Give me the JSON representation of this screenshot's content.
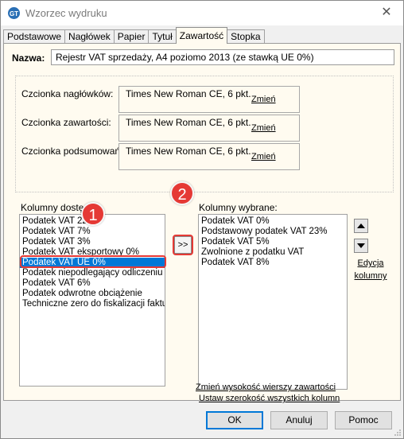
{
  "window": {
    "title": "Wzorzec wydruku",
    "close_icon": "close-icon"
  },
  "tabs": [
    {
      "label": "Podstawowe",
      "active": false
    },
    {
      "label": "Nagłówek",
      "active": false
    },
    {
      "label": "Papier",
      "active": false
    },
    {
      "label": "Tytuł",
      "active": false
    },
    {
      "label": "Zawartość",
      "active": true
    },
    {
      "label": "Stopka",
      "active": false
    }
  ],
  "name": {
    "label": "Nazwa:",
    "value": "Rejestr VAT sprzedaży, A4 poziomo 2013 (ze stawką UE 0%)"
  },
  "fonts": [
    {
      "label": "Czcionka nagłówków:",
      "value": "Times New Roman CE, 6 pkt.",
      "change": "Zmień"
    },
    {
      "label": "Czcionka zawartości:",
      "value": "Times New Roman CE, 6 pkt.",
      "change": "Zmień"
    },
    {
      "label": "Czcionka podsumowań:",
      "value": "Times New Roman CE, 6 pkt.",
      "change": "Zmień"
    }
  ],
  "available": {
    "label": "Kolumny dostępne:",
    "items": [
      "Podatek VAT 22%",
      "Podatek VAT 7%",
      "Podatek VAT 3%",
      "Podatek VAT eksportowy 0%",
      "Podatek VAT UE 0%",
      "Podatek niepodlegający odliczeniu",
      "Podatek VAT 6%",
      "Podatek odwrotne obciążenie",
      "Techniczne zero do fiskalizacji faktur r"
    ],
    "selected_index": 4
  },
  "move_button": ">>",
  "selected_columns": {
    "label": "Kolumny wybrane:",
    "items": [
      "Podatek VAT 0%",
      "Podstawowy podatek VAT 23%",
      "Podatek VAT 5%",
      "Zwolnione z podatku VAT",
      "Podatek VAT 8%"
    ]
  },
  "edit_columns": {
    "line1": "Edycja",
    "line2": "kolumny"
  },
  "links": {
    "set_width": "Ustaw szerokość wszystkich kolumn",
    "change_height": "Zmień wysokość wierszy zawartości"
  },
  "callouts": {
    "one": "1",
    "two": "2"
  },
  "buttons": {
    "ok": "OK",
    "cancel": "Anuluj",
    "help": "Pomoc"
  },
  "colors": {
    "accent": "#0078d7",
    "callout": "#e53935",
    "panel": "#fffbf0"
  }
}
